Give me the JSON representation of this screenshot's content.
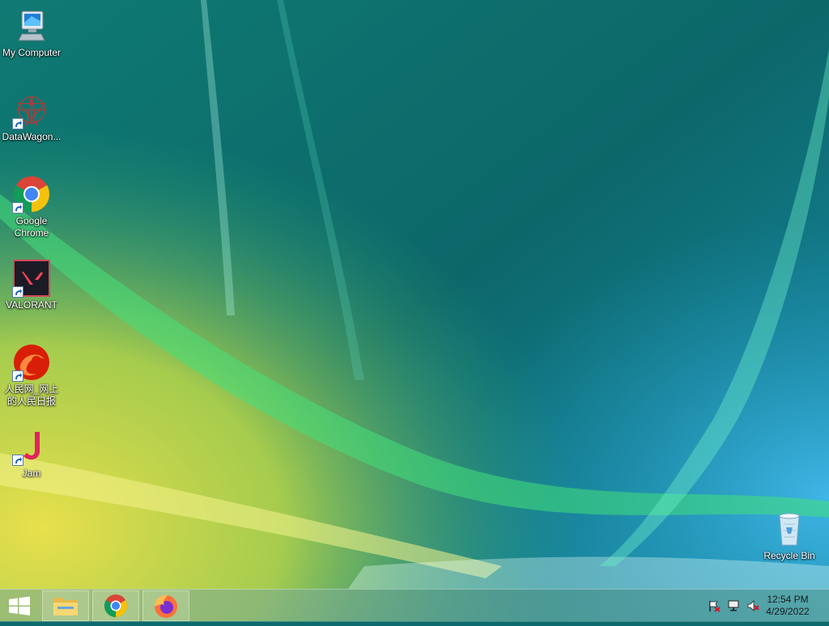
{
  "desktop": {
    "icons": [
      {
        "label": "My Computer",
        "icon": "computer-icon"
      },
      {
        "label": "DataWagon...",
        "icon": "datawagon-icon"
      },
      {
        "label": "Google Chrome",
        "icon": "chrome-icon"
      },
      {
        "label": "VALORANT",
        "icon": "valorant-icon"
      },
      {
        "label": "人民网_网上的人民日报",
        "icon": "people-daily-icon"
      },
      {
        "label": "Jam",
        "icon": "jam-icon"
      },
      {
        "label": "Recycle Bin",
        "icon": "recycle-bin-icon"
      }
    ]
  },
  "taskbar": {
    "start_icon": "windows-logo-icon",
    "pinned": [
      {
        "icon": "file-explorer-icon"
      },
      {
        "icon": "chrome-icon"
      },
      {
        "icon": "firefox-icon"
      }
    ],
    "tray": [
      {
        "icon": "action-center-flag-icon"
      },
      {
        "icon": "network-icon"
      },
      {
        "icon": "volume-muted-icon"
      }
    ],
    "clock": {
      "time": "12:54 PM",
      "date": "4/29/2022"
    }
  },
  "colors": {
    "wallpaper_teal": "#0d6b6e",
    "wallpaper_yellow": "#d9de52",
    "wallpaper_green": "#3fd86a"
  }
}
